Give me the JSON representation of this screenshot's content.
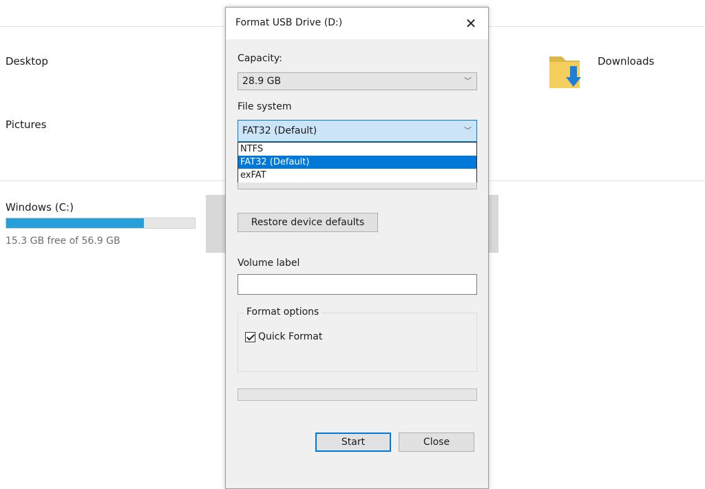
{
  "explorer": {
    "desktop_label": "Desktop",
    "pictures_label": "Pictures",
    "downloads_label": "Downloads",
    "drive": {
      "name": "Windows (C:)",
      "free_text": "15.3 GB free of 56.9 GB",
      "used_fraction": 0.73,
      "bar_color": "#26a0da"
    },
    "folder_icon": "downloads-folder-icon"
  },
  "dialog": {
    "title": "Format USB Drive (D:)",
    "close_icon": "close-icon",
    "capacity": {
      "label": "Capacity:",
      "value": "28.9 GB"
    },
    "file_system": {
      "label": "File system",
      "value": "FAT32 (Default)",
      "options": [
        "NTFS",
        "FAT32 (Default)",
        "exFAT"
      ],
      "selected_index": 1
    },
    "restore_button": "Restore device defaults",
    "volume_label": {
      "label": "Volume label",
      "value": ""
    },
    "format_options": {
      "legend": "Format options",
      "quick_format": {
        "label": "Quick Format",
        "checked": true
      }
    },
    "progress_fraction": 0,
    "buttons": {
      "start": "Start",
      "close": "Close"
    },
    "accent_color": "#0078d7"
  }
}
